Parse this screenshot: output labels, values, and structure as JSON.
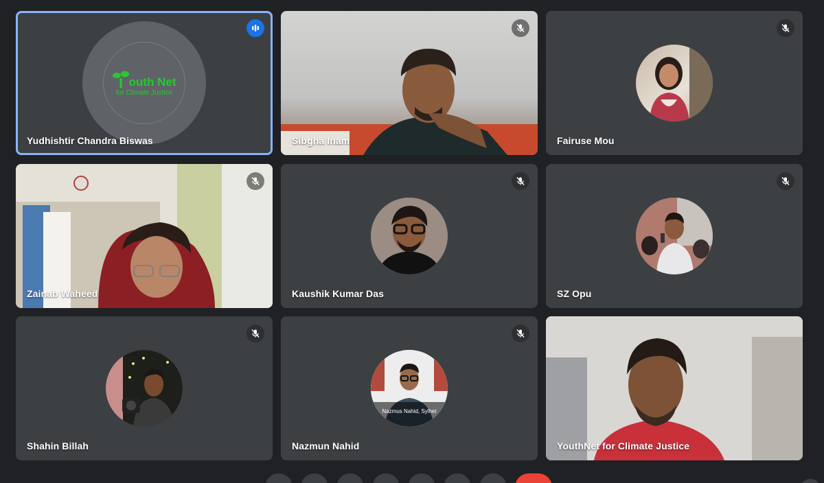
{
  "participants": [
    {
      "name": "Yudhishtir Chandra Biswas",
      "state": "speaking",
      "icon": "audio-level-icon"
    },
    {
      "name": "Sibgha Inam",
      "state": "muted",
      "icon": "mic-off-icon"
    },
    {
      "name": "Fairuse Mou",
      "state": "muted",
      "icon": "mic-off-icon"
    },
    {
      "name": "Zainab Waheed",
      "state": "muted",
      "icon": "mic-off-icon"
    },
    {
      "name": "Kaushik Kumar Das",
      "state": "muted",
      "icon": "mic-off-icon"
    },
    {
      "name": "SZ Opu",
      "state": "muted",
      "icon": "mic-off-icon"
    },
    {
      "name": "Shahin Billah",
      "state": "muted",
      "icon": "mic-off-icon"
    },
    {
      "name": "Nazmun Nahid",
      "state": "muted",
      "icon": "mic-off-icon"
    },
    {
      "name": "YouthNet for Climate Justice",
      "state": "video",
      "icon": ""
    }
  ],
  "logo": {
    "title_letter": "Y",
    "title_rest": "outh Net",
    "subtitle": "for Climate Justice"
  },
  "avatar_captions": {
    "nazmun": "Nazmus Nahid, Sylhet"
  },
  "colors": {
    "background": "#202124",
    "tile": "#3c4043",
    "active_border": "#8ab4f8",
    "speaking_badge": "#1a73e8",
    "logo_green": "#28c832",
    "end_call": "#ea4335"
  }
}
